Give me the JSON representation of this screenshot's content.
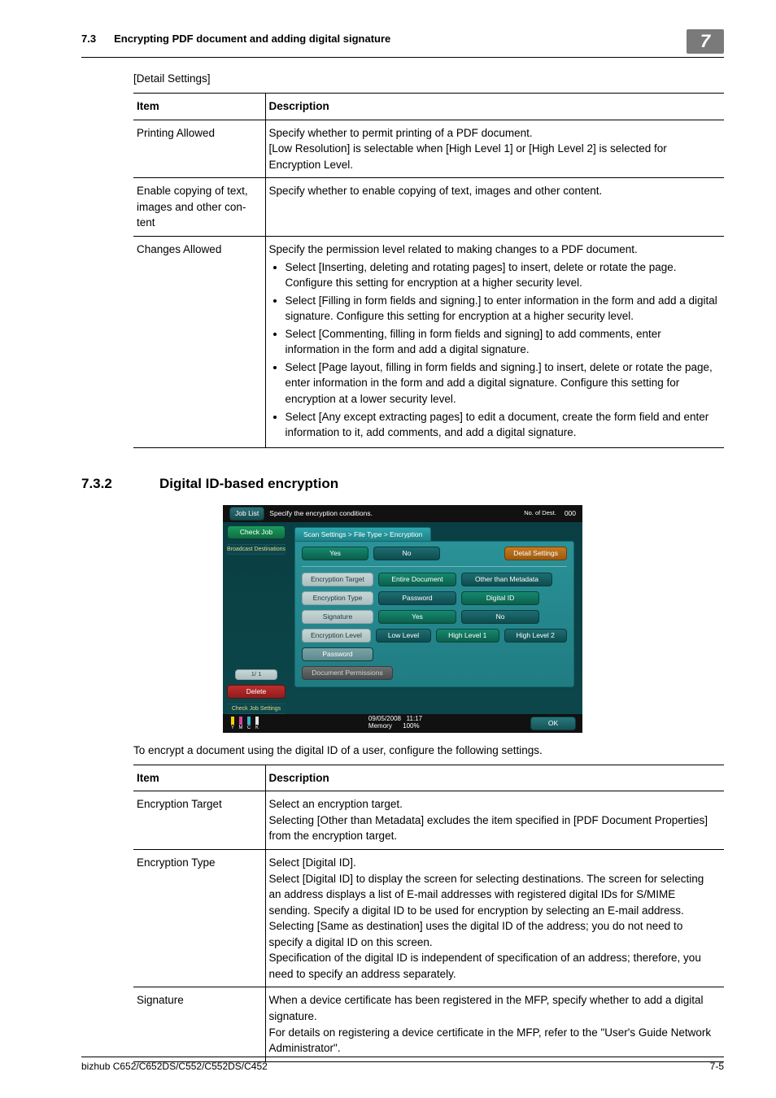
{
  "header": {
    "section_no": "7.3",
    "section_title": "Encrypting PDF document and adding digital signature",
    "chapter": "7"
  },
  "detail_caption": "[Detail Settings]",
  "table1": {
    "head_item": "Item",
    "head_desc": "Description",
    "rows": [
      {
        "item": "Printing Allowed",
        "desc": "Specify whether to permit printing of a PDF document.\n[Low Resolution] is selectable when [High Level 1] or [High Level 2] is selected for Encryption Level."
      },
      {
        "item": "Enable copying of text, images and other con­tent",
        "desc": "Specify whether to enable copying of text, images and other content."
      },
      {
        "item": "Changes Allowed",
        "desc_intro": "Specify the permission level related to making changes to a PDF document.",
        "bullets": [
          "Select [Inserting, deleting and rotating pages] to insert, delete or rotate the page. Configure this setting for encryption at a higher security level.",
          "Select [Filling in form fields and signing.] to enter information in the form and add a digital signature. Configure this setting for encryption at a higher security level.",
          "Select [Commenting, filling in form fields and signing] to add comments, enter information in the form and add a digital signature.",
          "Select [Page layout, filling in form fields and signing.] to insert, delete or ro­tate the page, enter information in the form and add a digital signature. Configure this setting for encryption at a lower security level.",
          "Select [Any except extracting pages] to edit a document, create the form field and enter information to it, add comments, and add a digital signature."
        ]
      }
    ]
  },
  "h2": {
    "num": "7.3.2",
    "title": "Digital ID-based encryption"
  },
  "shot": {
    "title": "Specify the encryption conditions.",
    "dest_label": "No. of Dest.",
    "dest_count": "000",
    "job_list": "Job List",
    "check_job": "Check Job",
    "broadcast": "Broadcast Destinations",
    "page_ind": "1/  1",
    "delete": "Delete",
    "check_set": "Check Job Settings",
    "crumb": "Scan Settings > File Type > Encryption",
    "yes": "Yes",
    "no": "No",
    "detail": "Detail Settings",
    "enc_target": "Encryption Target",
    "entire_doc": "Entire Document",
    "other_meta": "Other than Metadata",
    "enc_type": "Encryption Type",
    "password": "Password",
    "digital_id": "Digital ID",
    "signature": "Signature",
    "sig_yes": "Yes",
    "sig_no": "No",
    "enc_level": "Encryption Level",
    "low": "Low Level",
    "h1": "High Level 1",
    "h2": "High Level 2",
    "pw_btn": "Password",
    "doc_perm": "Document Permissions",
    "ok": "OK",
    "date": "09/05/2008",
    "time": "11:17",
    "mem_label": "Memory",
    "mem_val": "100%",
    "toners": [
      "Y",
      "M",
      "C",
      "K"
    ]
  },
  "p_after_shot": "To encrypt a document using the digital ID of a user, configure the following settings.",
  "table2": {
    "head_item": "Item",
    "head_desc": "Description",
    "rows": [
      {
        "item": "Encryption Target",
        "desc": "Select an encryption target.\nSelecting [Other than Metadata] excludes the item specified in [PDF Document Properties] from the encryption target."
      },
      {
        "item": "Encryption Type",
        "desc": "Select [Digital ID].\nSelect [Digital ID] to display the screen for selecting destinations. The screen for selecting an address displays a list of E-mail addresses with registered dig­ital IDs for S/MIME sending. Specify a digital ID to be used for encryption by selecting an E-mail address.\nSelecting [Same as destination] uses the digital ID of the address; you do not need to specify a digital ID on this screen.\nSpecification of the digital ID is independent of specification of an address; therefore, you need to specify an address separately."
      },
      {
        "item": "Signature",
        "desc": "When a device certificate has been registered in the MFP, specify whether to add a digital signature.\nFor details on registering a device certificate in the MFP, refer to the \"User's Guide Network Administrator\"."
      }
    ]
  },
  "footer": {
    "model": "bizhub C652/C652DS/C552/C552DS/C452",
    "page": "7-5"
  }
}
